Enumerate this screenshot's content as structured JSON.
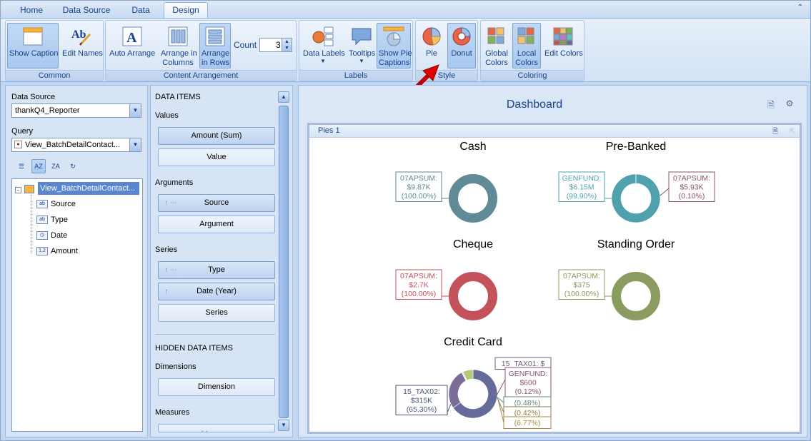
{
  "tabs": [
    "Home",
    "Data Source",
    "Data",
    "Design"
  ],
  "active_tab": "Design",
  "ribbon": {
    "common": {
      "label": "Common",
      "show_caption": "Show Caption",
      "edit_names": "Edit Names"
    },
    "content": {
      "label": "Content Arrangement",
      "auto_arrange": "Auto Arrange",
      "arrange_columns_1": "Arrange in",
      "arrange_columns_2": "Columns",
      "arrange_rows_1": "Arrange",
      "arrange_rows_2": "in Rows",
      "count_label": "Count",
      "count_value": "3"
    },
    "labels": {
      "label": "Labels",
      "data_labels": "Data Labels",
      "tooltips": "Tooltips",
      "show_pie_1": "Show Pie",
      "show_pie_2": "Captions"
    },
    "style": {
      "label": "Style",
      "pie": "Pie",
      "donut": "Donut"
    },
    "coloring": {
      "label": "Coloring",
      "global_1": "Global",
      "global_2": "Colors",
      "local_1": "Local",
      "local_2": "Colors",
      "edit_colors": "Edit Colors"
    }
  },
  "left": {
    "data_source_label": "Data Source",
    "data_source_value": "thankQ4_Reporter",
    "query_label": "Query",
    "query_value": "View_BatchDetailContact...",
    "tree_root": "View_BatchDetailContact...",
    "fields": [
      {
        "name": "Source",
        "type": "ab"
      },
      {
        "name": "Type",
        "type": "ab"
      },
      {
        "name": "Date",
        "type": "clock"
      },
      {
        "name": "Amount",
        "type": "1,2"
      }
    ]
  },
  "items": {
    "data_items": "DATA ITEMS",
    "values_label": "Values",
    "values": [
      "Amount (Sum)",
      "Value"
    ],
    "arguments_label": "Arguments",
    "arguments": [
      "Source",
      "Argument"
    ],
    "series_label": "Series",
    "series": [
      "Type",
      "Date (Year)",
      "Series"
    ],
    "hidden": "HIDDEN DATA ITEMS",
    "dimensions_label": "Dimensions",
    "dimensions": [
      "Dimension"
    ],
    "measures_label": "Measures",
    "measures": [
      "Measure"
    ]
  },
  "dashboard": {
    "title": "Dashboard",
    "panel_title": "Pies 1"
  },
  "chart_data": {
    "type": "pie",
    "style": "donut",
    "pies": [
      {
        "title": "Cash",
        "color": "#5f8a96",
        "slices": [
          {
            "argument": "07APSUM",
            "value": "$9.87K",
            "percent": 100.0
          }
        ]
      },
      {
        "title": "Pre-Banked",
        "color": "#4fa1ae",
        "slices": [
          {
            "argument": "GENFUND",
            "value": "$6.15M",
            "percent": 99.9
          },
          {
            "argument": "07APSUM",
            "value": "$5.93K",
            "percent": 0.1
          }
        ]
      },
      {
        "title": "Cheque",
        "color": "#c4525a",
        "slices": [
          {
            "argument": "07APSUM",
            "value": "$2.7K",
            "percent": 100.0
          }
        ]
      },
      {
        "title": "Standing Order",
        "color": "#8a9c5f",
        "slices": [
          {
            "argument": "07APSUM",
            "value": "$375",
            "percent": 100.0
          }
        ]
      },
      {
        "title": "Credit Card",
        "color": "#646b9a",
        "slices": [
          {
            "argument": "15_TAX02",
            "value": "$315K",
            "percent": 65.3
          },
          {
            "argument": "15_TAX01",
            "value": "$",
            "percent": 26.91
          },
          {
            "argument": "GENFUND",
            "value": "$600",
            "percent": 0.12
          },
          {
            "argument": "",
            "value": "",
            "percent": 0.48
          },
          {
            "argument": "",
            "value": "",
            "percent": 0.42
          },
          {
            "argument": "",
            "value": "",
            "percent": 6.77
          }
        ]
      }
    ],
    "labels": {
      "cash": [
        "07APSUM:",
        "$9.87K",
        "(100.00%)"
      ],
      "prebanked_left": [
        "GENFUND:",
        "$6.15M",
        "(99.90%)"
      ],
      "prebanked_right": [
        "07APSUM:",
        "$5.93K",
        "(0.10%)"
      ],
      "cheque": [
        "07APSUM:",
        "$2.7K",
        "(100.00%)"
      ],
      "standing": [
        "07APSUM:",
        "$375",
        "(100.00%)"
      ],
      "cc_left": [
        "15_TAX02:",
        "$315K",
        "(65.30%)"
      ],
      "cc_top": [
        "15_TAX01: $"
      ],
      "cc_gen": [
        "GENFUND:",
        "$600",
        "(0.12%)"
      ],
      "cc_p1": [
        "(0.48%)"
      ],
      "cc_p2": [
        "(0.42%)"
      ],
      "cc_p3": [
        "(6.77%)"
      ]
    }
  }
}
